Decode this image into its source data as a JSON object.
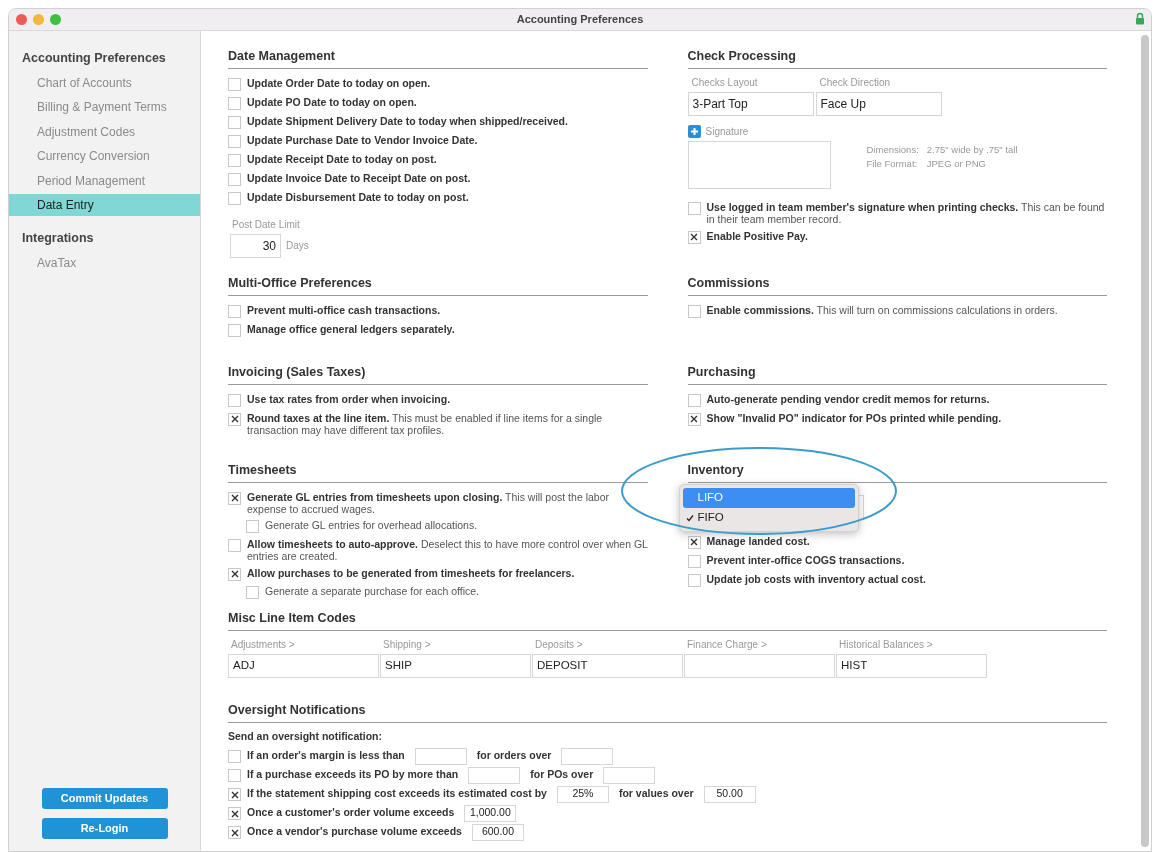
{
  "window": {
    "title": "Accounting Preferences"
  },
  "sidebar": {
    "groups": [
      {
        "title": "Accounting Preferences",
        "items": [
          {
            "label": "Chart of Accounts",
            "selected": false
          },
          {
            "label": "Billing & Payment Terms",
            "selected": false
          },
          {
            "label": "Adjustment Codes",
            "selected": false
          },
          {
            "label": "Currency Conversion",
            "selected": false
          },
          {
            "label": "Period Management",
            "selected": false
          },
          {
            "label": "Data Entry",
            "selected": true
          }
        ]
      },
      {
        "title": "Integrations",
        "items": [
          {
            "label": "AvaTax",
            "selected": false
          }
        ]
      }
    ],
    "buttons": [
      "Commit Updates",
      "Re-Login"
    ]
  },
  "rows": [
    {
      "left": {
        "title": "Date Management",
        "options": [
          {
            "label": "Update Order Date to today on open.",
            "checked": false
          },
          {
            "label": "Update PO Date to today on open.",
            "checked": false
          },
          {
            "label": "Update Shipment Delivery Date to today when shipped/received.",
            "checked": false
          },
          {
            "label": "Update Purchase Date to Vendor Invoice Date.",
            "checked": false
          },
          {
            "label": "Update Receipt Date to today on post.",
            "checked": false
          },
          {
            "label": "Update Invoice Date to Receipt Date on post.",
            "checked": false
          },
          {
            "label": "Update Disbursement Date to today on post.",
            "checked": false
          }
        ],
        "post_date_limit": {
          "label": "Post Date Limit",
          "value": "30",
          "unit": "Days"
        }
      },
      "right": {
        "title": "Check Processing",
        "fields": [
          {
            "label": "Checks Layout",
            "value": "3-Part Top"
          },
          {
            "label": "Check Direction",
            "value": "Face Up"
          }
        ],
        "signature": {
          "label": "Signature",
          "info": [
            {
              "label": "Dimensions:",
              "value": "2.75\" wide by .75\" tall"
            },
            {
              "label": "File Format:",
              "value": "JPEG or PNG"
            }
          ]
        },
        "options": [
          {
            "label": "Use logged in team member's signature when printing checks.",
            "note": "This can be found in their team member record.",
            "checked": false
          },
          {
            "label": "Enable Positive Pay.",
            "checked": true
          }
        ]
      }
    },
    {
      "left": {
        "title": "Multi-Office Preferences",
        "options": [
          {
            "label": "Prevent multi-office cash transactions.",
            "checked": false
          },
          {
            "label": "Manage office general ledgers separately.",
            "checked": false
          }
        ]
      },
      "right": {
        "title": "Commissions",
        "options": [
          {
            "label": "Enable commissions.",
            "note": "This will turn on commissions calculations in orders.",
            "checked": false
          }
        ]
      }
    },
    {
      "left": {
        "title": "Invoicing (Sales Taxes)",
        "options": [
          {
            "label": "Use tax rates from order when invoicing.",
            "checked": false
          },
          {
            "label": "Round taxes at the line item.",
            "note": "This must be enabled if line items for a single transaction may have different tax profiles.",
            "checked": true
          }
        ]
      },
      "right": {
        "title": "Purchasing",
        "options": [
          {
            "label": "Auto-generate pending vendor credit memos for returns.",
            "checked": false
          },
          {
            "label": "Show \"Invalid PO\" indicator for POs printed while pending.",
            "checked": true
          }
        ]
      }
    },
    {
      "left": {
        "title": "Timesheets",
        "options": [
          {
            "label": "Generate GL entries from timesheets upon closing.",
            "note": "This will post the labor expense to accrued wages.",
            "checked": true,
            "children": [
              {
                "label": "Generate GL entries for overhead allocations.",
                "checked": false
              }
            ]
          },
          {
            "label": "Allow timesheets to auto-approve.",
            "note": "Deselect this to have more control over when GL entries are created.",
            "checked": false
          },
          {
            "label": "Allow purchases to be generated from timesheets for freelancers.",
            "checked": true,
            "children": [
              {
                "label": "Generate a separate purchase for each office.",
                "checked": false
              }
            ]
          }
        ]
      },
      "right": {
        "title": "Inventory",
        "menu": [
          {
            "label": "LIFO",
            "highlighted": true,
            "selected": false
          },
          {
            "label": "FIFO",
            "highlighted": false,
            "selected": true
          }
        ],
        "options": [
          {
            "label": "Manage landed cost.",
            "checked": true
          },
          {
            "label": "Prevent inter-office COGS transactions.",
            "checked": false
          },
          {
            "label": "Update job costs with inventory actual cost.",
            "checked": false
          }
        ]
      }
    }
  ],
  "misc_codes": {
    "title": "Misc Line Item Codes",
    "fields": [
      {
        "label": "Adjustments >",
        "value": "ADJ"
      },
      {
        "label": "Shipping >",
        "value": "SHIP"
      },
      {
        "label": "Deposits >",
        "value": "DEPOSIT"
      },
      {
        "label": "Finance Charge >"
      },
      {
        "label": "Historical Balances >",
        "value": "HIST"
      }
    ]
  },
  "oversight": {
    "title": "Oversight Notifications",
    "intro": "Send an oversight notification:",
    "rows": [
      {
        "checked": false,
        "parts": [
          {
            "kind": "text",
            "text": "If an order's margin is less than"
          },
          {
            "kind": "field"
          },
          {
            "kind": "text",
            "text": "for orders over"
          },
          {
            "kind": "field"
          }
        ]
      },
      {
        "checked": false,
        "parts": [
          {
            "kind": "text",
            "text": "If a purchase exceeds its PO by more than"
          },
          {
            "kind": "field"
          },
          {
            "kind": "text",
            "text": "for POs over"
          },
          {
            "kind": "field"
          }
        ]
      },
      {
        "checked": true,
        "parts": [
          {
            "kind": "text",
            "text": "If the statement shipping cost exceeds its estimated cost by"
          },
          {
            "kind": "field",
            "value": "25%"
          },
          {
            "kind": "text",
            "text": "for values over"
          },
          {
            "kind": "field",
            "value": "50.00"
          }
        ]
      },
      {
        "checked": true,
        "parts": [
          {
            "kind": "text",
            "text": "Once a customer's order volume exceeds"
          },
          {
            "kind": "field",
            "value": "1,000.00"
          }
        ]
      },
      {
        "checked": true,
        "parts": [
          {
            "kind": "text",
            "text": "Once a vendor's purchase volume exceeds"
          },
          {
            "kind": "field",
            "value": "600.00"
          }
        ]
      }
    ]
  }
}
